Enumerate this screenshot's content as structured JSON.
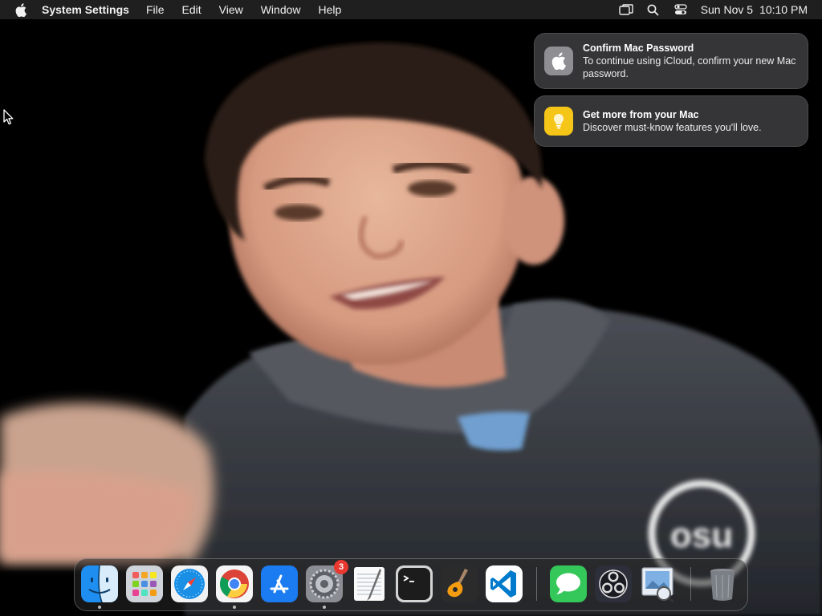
{
  "menubar": {
    "app_name": "System Settings",
    "menus": [
      "File",
      "Edit",
      "View",
      "Window",
      "Help"
    ],
    "date": "Sun Nov 5",
    "time": "10:10 PM",
    "status_icons": [
      "screen-mirroring-icon",
      "spotlight-search-icon",
      "control-center-icon"
    ]
  },
  "notifications": [
    {
      "icon": "apple-logo-icon",
      "title": "Confirm Mac Password",
      "body": "To continue using iCloud, confirm your new Mac password."
    },
    {
      "icon": "lightbulb-icon",
      "title": "Get more from your Mac",
      "body": "Discover must-know features you'll love."
    }
  ],
  "wallpaper": {
    "text": "osu"
  },
  "dock": {
    "apps": [
      {
        "name": "Finder",
        "icon": "finder-icon",
        "running": true
      },
      {
        "name": "Launchpad",
        "icon": "launchpad-icon",
        "running": false
      },
      {
        "name": "Safari",
        "icon": "safari-icon",
        "running": false
      },
      {
        "name": "Google Chrome",
        "icon": "chrome-icon",
        "running": true
      },
      {
        "name": "App Store",
        "icon": "app-store-icon",
        "running": false
      },
      {
        "name": "System Settings",
        "icon": "system-settings-icon",
        "running": true,
        "badge": "3"
      },
      {
        "name": "TextEdit",
        "icon": "textedit-icon",
        "running": false
      },
      {
        "name": "Terminal",
        "icon": "terminal-icon",
        "running": false
      },
      {
        "name": "GarageBand",
        "icon": "garageband-icon",
        "running": false
      },
      {
        "name": "Visual Studio Code",
        "icon": "vscode-icon",
        "running": false
      },
      {
        "name": "Messages",
        "icon": "messages-icon",
        "running": false
      },
      {
        "name": "OBS",
        "icon": "obs-icon",
        "running": false
      },
      {
        "name": "Preview",
        "icon": "preview-icon",
        "running": false
      },
      {
        "name": "Trash",
        "icon": "trash-icon",
        "running": false
      }
    ]
  },
  "colors": {
    "menubar_bg": "#222222",
    "notification_bg": "#3a3a3c",
    "badge": "#e8382f",
    "wallpaper_bg": "#000000",
    "hoodie": "#2e3238"
  }
}
